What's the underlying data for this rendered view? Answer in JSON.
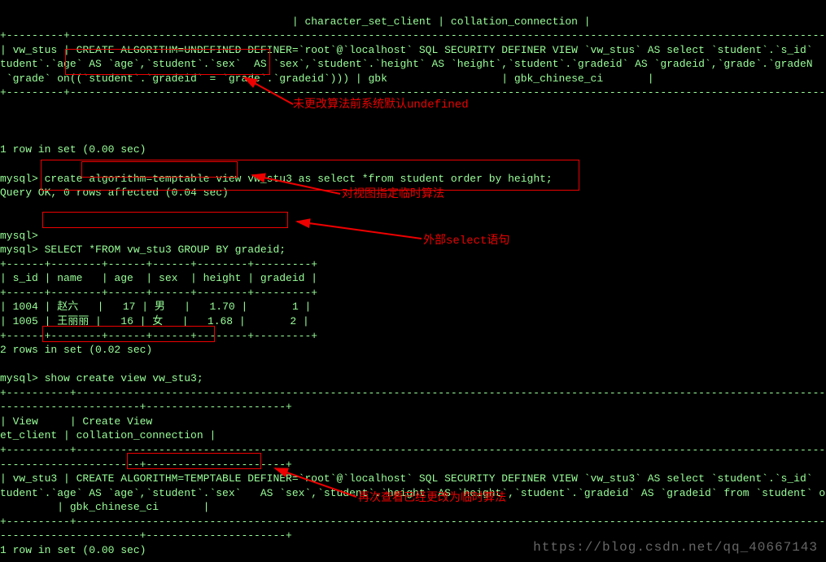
{
  "header_cols": "                                              | character_set_client | collation_connection |",
  "sep_long": "+---------+------------------------------------------------------------------------------------------------------------------------------------------------------------------------------------------------------------------------------------------------------------------------------------------------------------------------------------+",
  "view1_line1": "| vw_stus | CREATE ALGORITHM=UNDEFINED DEFINER=`root`@`localhost` SQL SECURITY DEFINER VIEW `vw_stus` AS select `student`.`s_id`",
  "view1_line2": "tudent`.`age` AS `age`,`student`.`sex`  AS `sex`,`student`.`height` AS `height`,`student`.`gradeid` AS `gradeid`,`grade`.`gradeN",
  "view1_line3": " `grade` on((`student`.`gradeid` = `grade`.`gradeid`))) | gbk                  | gbk_chinese_ci       |",
  "anno1": "未更改算法前系统默认undefined",
  "rows1": "1 row in set (0.00 sec)",
  "prompt": "mysql>",
  "cmd_create": "create algorithm=temptable view vw_stu3 as select *from student order by height;",
  "query_ok": "Query OK, 0 rows affected (0.04 sec)",
  "anno2": "对视图指定临时算法",
  "cmd_select": "SELECT *FROM vw_stu3 GROUP BY gradeid;",
  "anno3": "外部select语句",
  "tsep": "+------+--------+------+------+--------+---------+",
  "thead": "| s_id | name   | age  | sex  | height | gradeid |",
  "trow1_id": "1004",
  "trow1_name": "赵六",
  "trow1_age": "17",
  "trow1_sex": "男",
  "trow1_height": "1.70",
  "trow1_gradeid": "1",
  "trow2_id": "1005",
  "trow2_name": "王丽丽",
  "trow2_age": "16",
  "trow2_sex": "女",
  "trow2_height": "1.68",
  "trow2_gradeid": "2",
  "rows2": "2 rows in set (0.02 sec)",
  "cmd_show": "show create view vw_stu3;",
  "sep2": "+----------+-----------------------------------------------------------------------------------------------------------------------------------------------------------------------------------------------------------------------------------------------------------------------------------------------------------------------------------+",
  "col_view": "| View     | Create View",
  "col_cs": "et_client | collation_connection |",
  "view2_line1": "| vw_stu3 | CREATE ALGORITHM=TEMPTABLE DEFINER=`root`@`localhost` SQL SECURITY DEFINER VIEW `vw_stu3` AS select `student`.`s_id`",
  "view2_line2": "tudent`.`age` AS `age`,`student`.`sex`   AS `sex`,`student`.`height` AS `height`,`student`.`gradeid` AS `gradeid` from `student` o",
  "view2_line3": "         | gbk_chinese_ci       |",
  "anno4": "再次查看已经更改为临时算法",
  "rows3": "1 row in set (0.00 sec)",
  "watermark": "https://blog.csdn.net/qq_40667143"
}
